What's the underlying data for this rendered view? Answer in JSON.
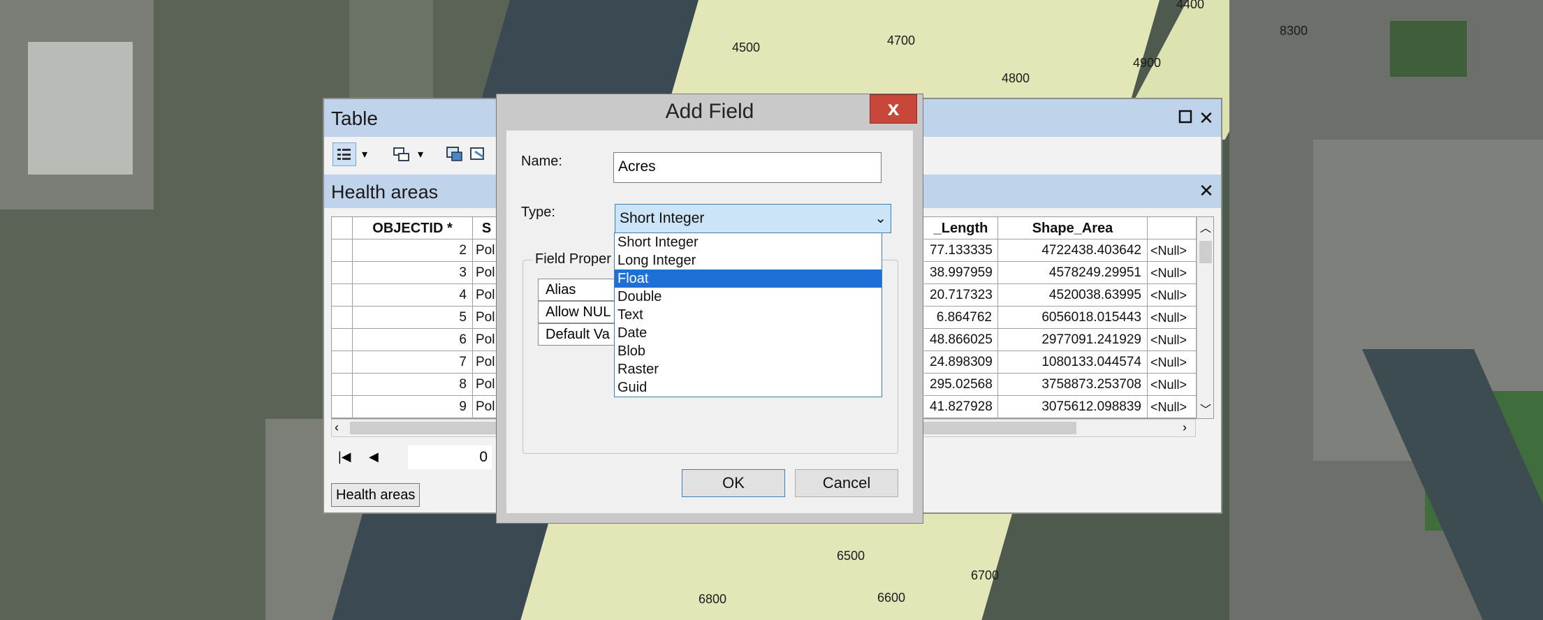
{
  "map": {
    "health_area_labels": [
      "4500",
      "4700",
      "4800",
      "4900",
      "8300",
      "4400",
      "6500",
      "6700",
      "6600",
      "6800"
    ]
  },
  "table_window": {
    "title": "Table",
    "maximize_icon": "square",
    "close_icon": "x",
    "tab_title": "Health areas",
    "bottom_tab_label": "Health areas",
    "record_position": "0",
    "columns": [
      "OBJECTID *",
      "S",
      "_Length",
      "Shape_Area"
    ],
    "rows": [
      {
        "objectid": "2",
        "shape": "Pol",
        "length": "77.133335",
        "area": "4722438.403642",
        "extra": "<Null>"
      },
      {
        "objectid": "3",
        "shape": "Pol",
        "length": "38.997959",
        "area": "4578249.29951",
        "extra": "<Null>"
      },
      {
        "objectid": "4",
        "shape": "Pol",
        "length": "20.717323",
        "area": "4520038.63995",
        "extra": "<Null>"
      },
      {
        "objectid": "5",
        "shape": "Pol",
        "length": "6.864762",
        "area": "6056018.015443",
        "extra": "<Null>"
      },
      {
        "objectid": "6",
        "shape": "Pol",
        "length": "48.866025",
        "area": "2977091.241929",
        "extra": "<Null>"
      },
      {
        "objectid": "7",
        "shape": "Pol",
        "length": "24.898309",
        "area": "1080133.044574",
        "extra": "<Null>"
      },
      {
        "objectid": "8",
        "shape": "Pol",
        "length": "295.02568",
        "area": "3758873.253708",
        "extra": "<Null>"
      },
      {
        "objectid": "9",
        "shape": "Pol",
        "length": "41.827928",
        "area": "3075612.098839",
        "extra": "<Null>"
      }
    ]
  },
  "dialog": {
    "title": "Add Field",
    "close_label": "x",
    "name_label": "Name:",
    "name_value": "Acres",
    "type_label": "Type:",
    "type_value": "Short Integer",
    "type_options": [
      "Short Integer",
      "Long Integer",
      "Float",
      "Double",
      "Text",
      "Date",
      "Blob",
      "Raster",
      "Guid"
    ],
    "type_highlighted": "Float",
    "field_properties_label": "Field Proper",
    "properties": [
      "Alias",
      "Allow NUL",
      "Default Va"
    ],
    "ok_label": "OK",
    "cancel_label": "Cancel"
  },
  "colors": {
    "titlebar": "#bfd3ea",
    "selection": "#1e6fd6",
    "close_red": "#c7473a",
    "parcel_fill": "#e3e7b7"
  }
}
